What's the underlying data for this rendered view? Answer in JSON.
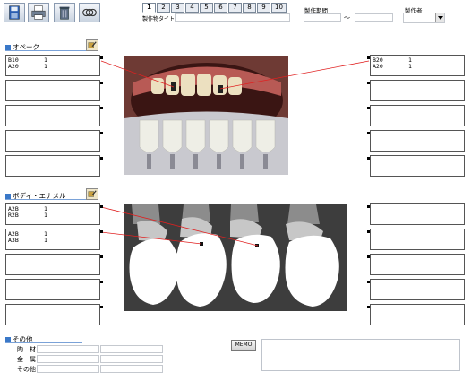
{
  "toolbar": {
    "buttons": [
      {
        "icon": "save-icon"
      },
      {
        "icon": "printer-icon"
      },
      {
        "icon": "trash-icon"
      },
      {
        "icon": "link-icon"
      }
    ]
  },
  "pages": {
    "tabs": [
      "1",
      "2",
      "3",
      "4",
      "5",
      "6",
      "7",
      "8",
      "9",
      "10"
    ],
    "active": "1",
    "title_label": "製作物タイトル"
  },
  "period": {
    "label": "製作期間",
    "separator": "〜"
  },
  "maker": {
    "label": "製作者"
  },
  "opaque": {
    "section_label": "オペーク",
    "left_boxes": [
      {
        "lines": [
          [
            "B10",
            "1"
          ],
          [
            "A20",
            "1"
          ]
        ]
      },
      {
        "lines": []
      },
      {
        "lines": []
      },
      {
        "lines": []
      },
      {
        "lines": []
      }
    ],
    "right_boxes": [
      {
        "lines": [
          [
            "B20",
            "1"
          ],
          [
            "A20",
            "1"
          ]
        ]
      },
      {
        "lines": []
      },
      {
        "lines": []
      },
      {
        "lines": []
      },
      {
        "lines": []
      }
    ]
  },
  "body_enamel": {
    "section_label": "ボディ・エナメル",
    "left_boxes": [
      {
        "lines": [
          [
            "A2B",
            "1"
          ],
          [
            "R2B",
            "1"
          ]
        ]
      },
      {
        "lines": [
          [
            "A2B",
            "1"
          ],
          [
            "A3B",
            "1"
          ]
        ]
      },
      {
        "lines": []
      },
      {
        "lines": []
      },
      {
        "lines": []
      }
    ],
    "right_boxes": [
      {
        "lines": []
      },
      {
        "lines": []
      },
      {
        "lines": []
      },
      {
        "lines": []
      },
      {
        "lines": []
      }
    ]
  },
  "other": {
    "section_label": "その他",
    "rows": [
      "陶　材",
      "金　属",
      "その他"
    ]
  },
  "memo": {
    "button_label": "MEMO"
  },
  "colors": {
    "accent": "#3a78c8",
    "leader_line": "#e02020"
  }
}
